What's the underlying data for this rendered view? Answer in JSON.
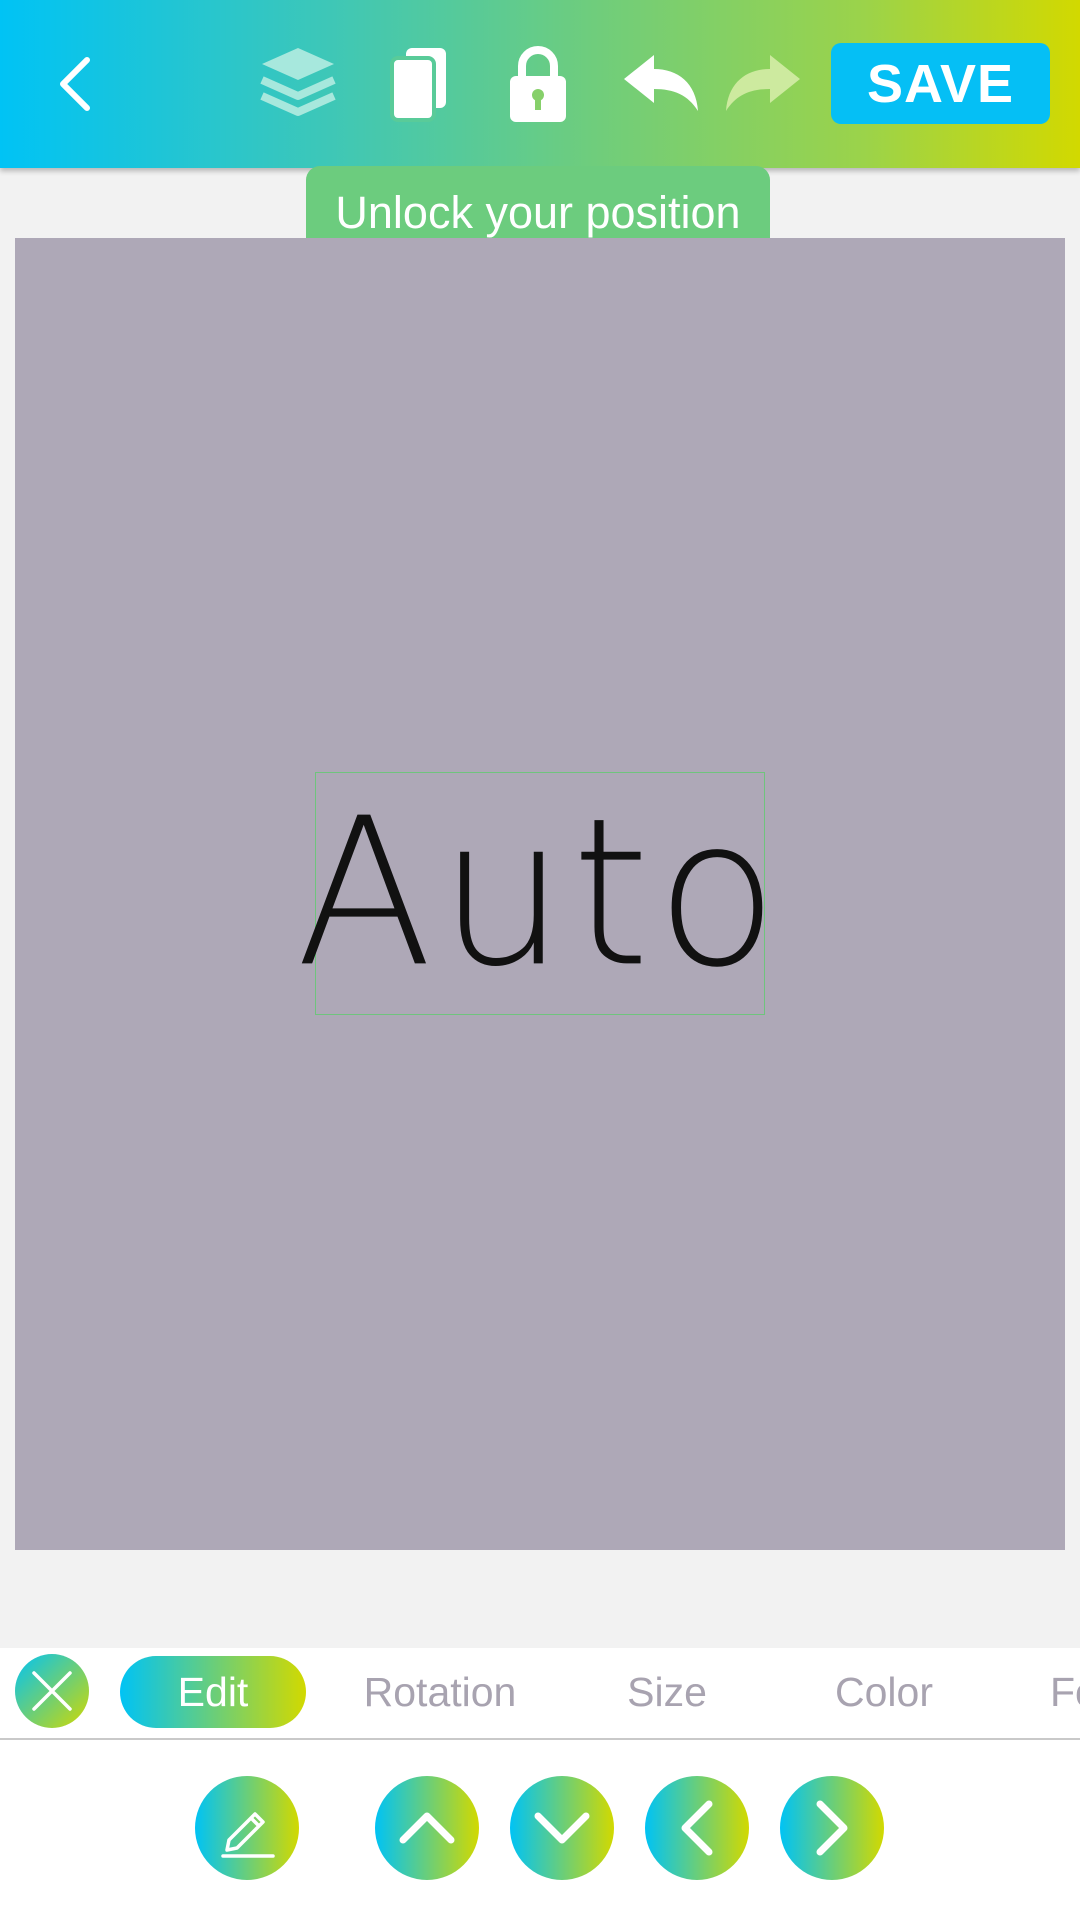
{
  "toolbar": {
    "save_label": "SAVE",
    "icons": [
      "back-icon",
      "layers-icon",
      "copy-icon",
      "lock-icon",
      "undo-icon",
      "redo-icon"
    ]
  },
  "tooltip": {
    "text": "Unlock your position"
  },
  "canvas": {
    "background_color": "#aea8b7",
    "text_content": "Auto"
  },
  "tabs": [
    {
      "label": "Edit",
      "active": true
    },
    {
      "label": "Rotation",
      "active": false
    },
    {
      "label": "Size",
      "active": false
    },
    {
      "label": "Color",
      "active": false
    },
    {
      "label": "Fo",
      "active": false
    }
  ],
  "actions": {
    "icons": [
      "edit-pencil-icon",
      "move-up-icon",
      "move-down-icon",
      "move-left-icon",
      "move-right-icon"
    ]
  },
  "colors": {
    "gradient_start": "#00c3f5",
    "gradient_end": "#d2d900",
    "save_bg": "#05bff5",
    "tooltip_bg": "#6ccc7e",
    "tab_inactive": "#a8a3b0"
  }
}
